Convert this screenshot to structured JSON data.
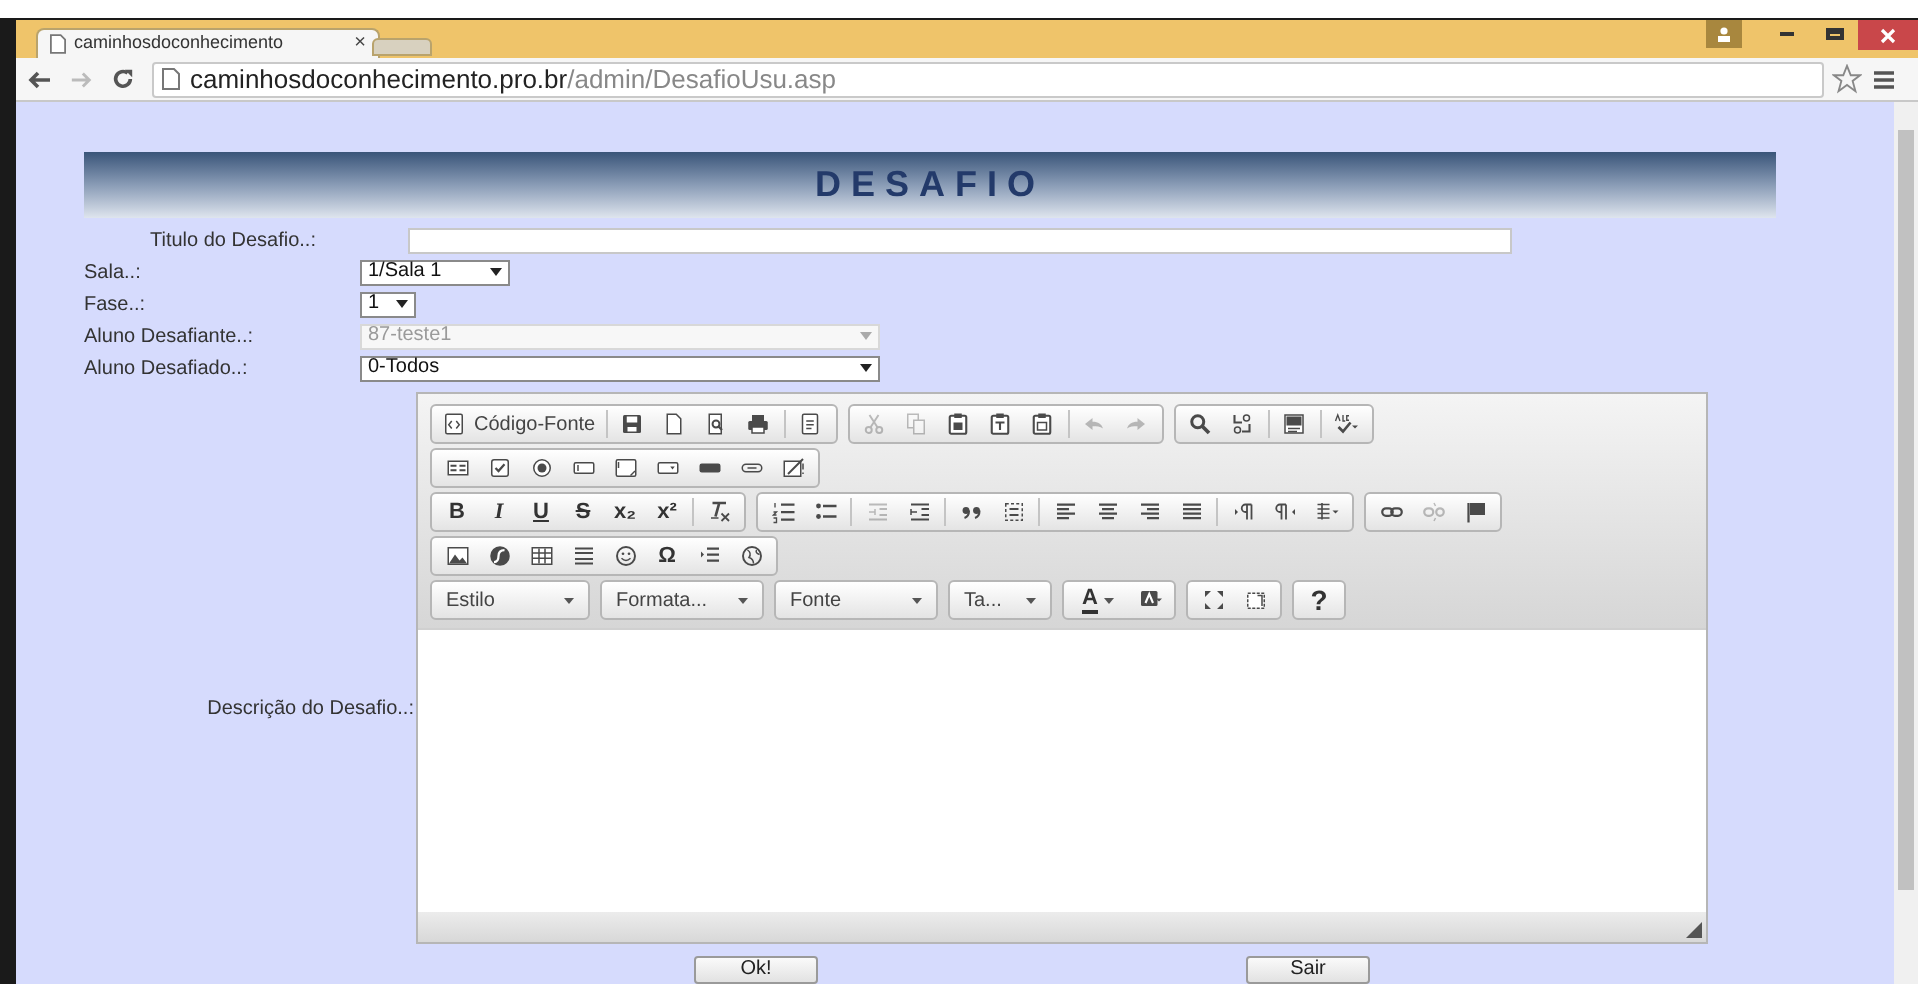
{
  "browser": {
    "tab_title": "caminhosdoconhecimento",
    "tab_close": "×",
    "url_host": "caminhosdoconhecimento.pro.br",
    "url_path": "/admin/DesafioUsu.asp"
  },
  "heading": "DESAFIO",
  "fields": [
    {
      "label": "Titulo do Desafio..:",
      "kind": "text",
      "disabled": false
    },
    {
      "label": "Sala..:",
      "kind": "select",
      "value": "1/Sala 1",
      "disabled": false
    },
    {
      "label": "Fase..:",
      "kind": "select",
      "value": "1",
      "disabled": false
    },
    {
      "label": "Aluno Desafiante..:",
      "kind": "select",
      "value": "87-teste1",
      "disabled": true
    },
    {
      "label": "Aluno Desafiado..:",
      "kind": "select",
      "value": "0-Todos",
      "disabled": false
    }
  ],
  "editor": {
    "label": "Descrição do Desafio..:",
    "toolbar": [
      [
        [
          [
            {
              "kind": "text",
              "label": "Código-Fonte",
              "disabled": false
            }
          ],
          [
            {
              "kind": "icon",
              "disabled": false
            },
            {
              "kind": "icon",
              "disabled": false
            },
            {
              "kind": "icon",
              "disabled": false
            },
            {
              "kind": "icon",
              "disabled": false
            }
          ],
          [
            {
              "kind": "icon",
              "disabled": false
            }
          ]
        ],
        [
          [
            {
              "kind": "icon",
              "disabled": true
            },
            {
              "kind": "icon",
              "disabled": true
            },
            {
              "kind": "icon",
              "disabled": false
            },
            {
              "kind": "icon",
              "disabled": false
            },
            {
              "kind": "icon",
              "disabled": false
            }
          ],
          [
            {
              "kind": "icon",
              "disabled": true
            },
            {
              "kind": "icon",
              "disabled": true
            }
          ]
        ],
        [
          [
            {
              "kind": "icon",
              "disabled": false
            },
            {
              "kind": "icon",
              "disabled": false
            }
          ],
          [
            {
              "kind": "icon",
              "disabled": false
            }
          ],
          [
            {
              "kind": "icon",
              "disabled": false
            }
          ]
        ]
      ],
      [
        [
          [
            {
              "kind": "icon",
              "disabled": false
            },
            {
              "kind": "icon",
              "disabled": false
            },
            {
              "kind": "icon",
              "disabled": false
            },
            {
              "kind": "icon",
              "disabled": false
            },
            {
              "kind": "icon",
              "disabled": false
            },
            {
              "kind": "icon",
              "disabled": false
            },
            {
              "kind": "icon",
              "disabled": false
            },
            {
              "kind": "icon",
              "disabled": false
            },
            {
              "kind": "icon",
              "disabled": false
            }
          ]
        ]
      ],
      [
        [
          [
            {
              "kind": "glyph",
              "label": "B",
              "disabled": false
            },
            {
              "kind": "glyph",
              "label": "I",
              "disabled": false
            },
            {
              "kind": "glyph",
              "label": "U",
              "disabled": false
            },
            {
              "kind": "glyph",
              "label": "S",
              "disabled": false
            },
            {
              "kind": "glyph",
              "label": "x₂",
              "disabled": false
            },
            {
              "kind": "glyph",
              "label": "x²",
              "disabled": false
            }
          ],
          [
            {
              "kind": "icon",
              "disabled": false
            }
          ]
        ],
        [
          [
            {
              "kind": "icon",
              "disabled": false
            },
            {
              "kind": "icon",
              "disabled": false
            }
          ],
          [
            {
              "kind": "icon",
              "disabled": true
            },
            {
              "kind": "icon",
              "disabled": false
            }
          ],
          [
            {
              "kind": "icon",
              "disabled": false
            },
            {
              "kind": "icon",
              "disabled": false
            }
          ],
          [
            {
              "kind": "icon",
              "disabled": false
            },
            {
              "kind": "icon",
              "disabled": false
            },
            {
              "kind": "icon",
              "disabled": false
            },
            {
              "kind": "icon",
              "disabled": false
            }
          ],
          [
            {
              "kind": "icon",
              "disabled": false
            },
            {
              "kind": "icon",
              "disabled": false
            },
            {
              "kind": "icon",
              "disabled": false
            }
          ]
        ],
        [
          [
            {
              "kind": "icon",
              "disabled": false
            },
            {
              "kind": "icon",
              "disabled": true
            },
            {
              "kind": "icon",
              "disabled": false
            }
          ]
        ]
      ],
      [
        [
          [
            {
              "kind": "icon",
              "disabled": false
            },
            {
              "kind": "icon",
              "disabled": false
            },
            {
              "kind": "icon",
              "disabled": false
            },
            {
              "kind": "icon",
              "disabled": false
            },
            {
              "kind": "icon",
              "disabled": false
            },
            {
              "kind": "glyph",
              "label": "Ω",
              "disabled": false
            },
            {
              "kind": "icon",
              "disabled": false
            },
            {
              "kind": "icon",
              "disabled": false
            }
          ]
        ]
      ],
      [
        [
          [
            {
              "kind": "combo",
              "label": "Estilo",
              "disabled": false
            }
          ]
        ],
        [
          [
            {
              "kind": "combo",
              "label": "Formata...",
              "disabled": false
            }
          ]
        ],
        [
          [
            {
              "kind": "combo",
              "label": "Fonte",
              "disabled": false
            }
          ]
        ],
        [
          [
            {
              "kind": "combo",
              "label": "Ta...",
              "disabled": false
            }
          ]
        ],
        [
          [
            {
              "kind": "color",
              "label": "A",
              "disabled": false
            },
            {
              "kind": "icon",
              "disabled": false
            }
          ]
        ],
        [
          [
            {
              "kind": "icon",
              "disabled": false
            },
            {
              "kind": "icon",
              "disabled": false
            }
          ]
        ],
        [
          [
            {
              "kind": "glyph",
              "label": "?",
              "disabled": false
            }
          ]
        ]
      ]
    ]
  },
  "buttons": [
    "Ok!",
    "Sair"
  ]
}
